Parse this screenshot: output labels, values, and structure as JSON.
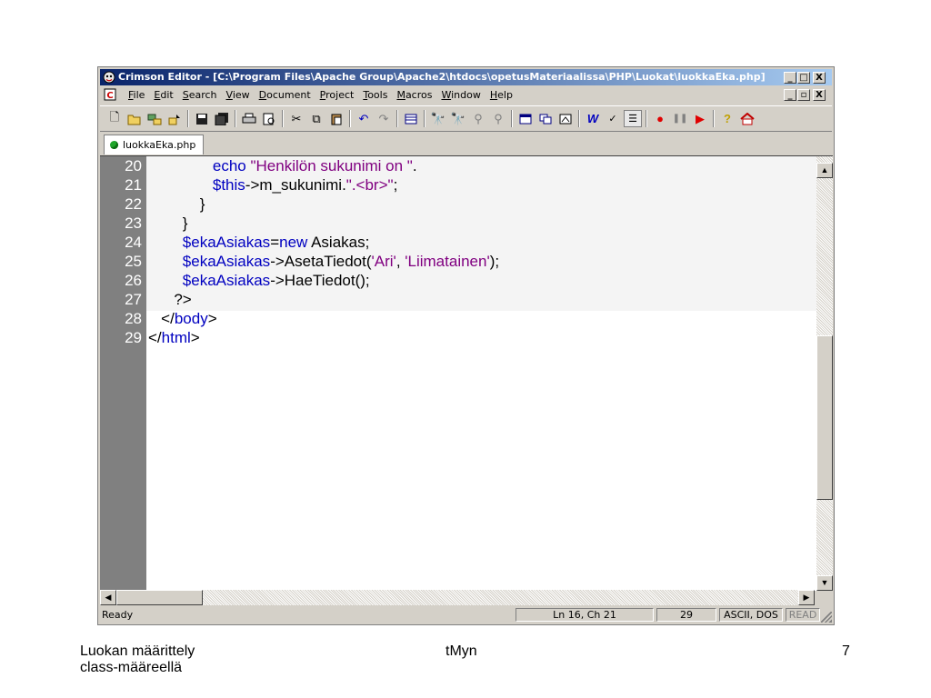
{
  "window": {
    "title": "Crimson Editor - [C:\\Program Files\\Apache Group\\Apache2\\htdocs\\opetusMateriaalissa\\PHP\\Luokat\\luokkaEka.php]",
    "caption_buttons": [
      "_",
      "□",
      "X"
    ],
    "mdi_buttons": [
      "_",
      "▫",
      "X"
    ]
  },
  "menu": {
    "items": [
      "File",
      "Edit",
      "Search",
      "View",
      "Document",
      "Project",
      "Tools",
      "Macros",
      "Window",
      "Help"
    ]
  },
  "toolbar": {
    "buttons": [
      "new-file-icon",
      "open-file-icon",
      "open-remote-icon",
      "save-remote-icon",
      "save-icon",
      "save-all-icon",
      "print-icon",
      "print-preview-icon",
      "cut-icon",
      "copy-icon",
      "paste-icon",
      "undo-icon",
      "redo-icon",
      "column-mode-icon",
      "find-icon",
      "find-next-icon",
      "replace-icon",
      "find-in-files-icon",
      "split-window-icon",
      "tile-window-icon",
      "view-toggle-icon",
      "word-wrap-icon",
      "spell-check-icon",
      "line-numbers-icon",
      "record-macro-icon",
      "pause-macro-icon",
      "play-macro-icon",
      "help-icon",
      "home-icon"
    ]
  },
  "tab": {
    "label": "luokkaEka.php"
  },
  "editor": {
    "lines": [
      {
        "num": "20",
        "indent": "               ",
        "parts": [
          {
            "t": "echo",
            "c": "kw"
          },
          {
            "t": " ",
            "c": ""
          },
          {
            "t": "\"Henkilön sukunimi on \"",
            "c": "str"
          },
          {
            "t": ".",
            "c": ""
          }
        ]
      },
      {
        "num": "21",
        "indent": "               ",
        "parts": [
          {
            "t": "$this",
            "c": "var"
          },
          {
            "t": "->m_sukunimi.",
            "c": ""
          },
          {
            "t": "\".<br>\"",
            "c": "str"
          },
          {
            "t": ";",
            "c": ""
          }
        ]
      },
      {
        "num": "22",
        "indent": "            ",
        "parts": [
          {
            "t": "}",
            "c": ""
          }
        ]
      },
      {
        "num": "23",
        "indent": "        ",
        "parts": [
          {
            "t": "}",
            "c": ""
          }
        ]
      },
      {
        "num": "24",
        "indent": "        ",
        "parts": [
          {
            "t": "$ekaAsiakas",
            "c": "var"
          },
          {
            "t": "=",
            "c": ""
          },
          {
            "t": "new",
            "c": "kw"
          },
          {
            "t": " Asiakas;",
            "c": ""
          }
        ]
      },
      {
        "num": "25",
        "indent": "        ",
        "parts": [
          {
            "t": "$ekaAsiakas",
            "c": "var"
          },
          {
            "t": "->AsetaTiedot(",
            "c": ""
          },
          {
            "t": "'Ari'",
            "c": "str"
          },
          {
            "t": ", ",
            "c": ""
          },
          {
            "t": "'Liimatainen'",
            "c": "str"
          },
          {
            "t": ");",
            "c": ""
          }
        ]
      },
      {
        "num": "26",
        "indent": "        ",
        "parts": [
          {
            "t": "$ekaAsiakas",
            "c": "var"
          },
          {
            "t": "->HaeTiedot();",
            "c": ""
          }
        ]
      },
      {
        "num": "27",
        "indent": "      ",
        "parts": [
          {
            "t": "?>",
            "c": ""
          }
        ]
      },
      {
        "num": "28",
        "indent": "   ",
        "parts": [
          {
            "t": "</",
            "c": ""
          },
          {
            "t": "body",
            "c": "kw"
          },
          {
            "t": ">",
            "c": ""
          }
        ]
      },
      {
        "num": "29",
        "indent": "",
        "parts": [
          {
            "t": "</",
            "c": ""
          },
          {
            "t": "html",
            "c": "kw"
          },
          {
            "t": ">",
            "c": ""
          }
        ]
      }
    ]
  },
  "status": {
    "ready": "Ready",
    "position": "Ln 16, Ch 21",
    "lines": "29",
    "encoding": "ASCII, DOS",
    "mode": "READ"
  },
  "footer": {
    "left_line1": "Luokan määrittely",
    "left_line2": "class-määreellä",
    "center": "tMyn",
    "page": "7"
  }
}
